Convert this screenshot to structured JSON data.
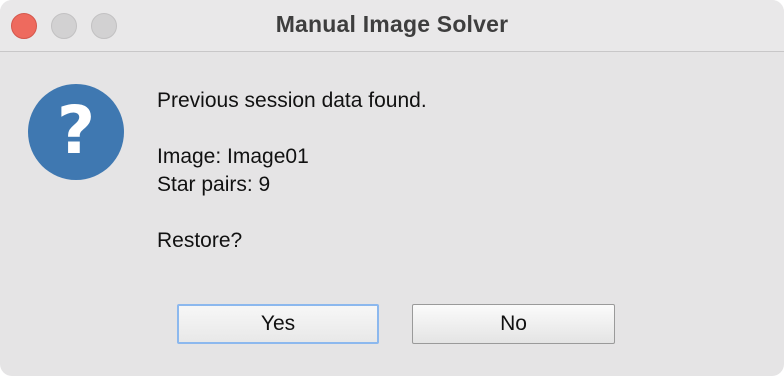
{
  "window": {
    "title": "Manual Image Solver"
  },
  "dialog": {
    "icon": "question-icon",
    "icon_glyph": "?",
    "icon_color": "#3f78b1",
    "line1": "Previous session data found.",
    "line2": "Image: Image01",
    "line3": "Star pairs: 9",
    "line4": "Restore?"
  },
  "buttons": {
    "yes_label": "Yes",
    "no_label": "No",
    "default_button": "Yes"
  },
  "colors": {
    "close": "#ee6a5e",
    "focus_ring": "#8cb8ee"
  }
}
